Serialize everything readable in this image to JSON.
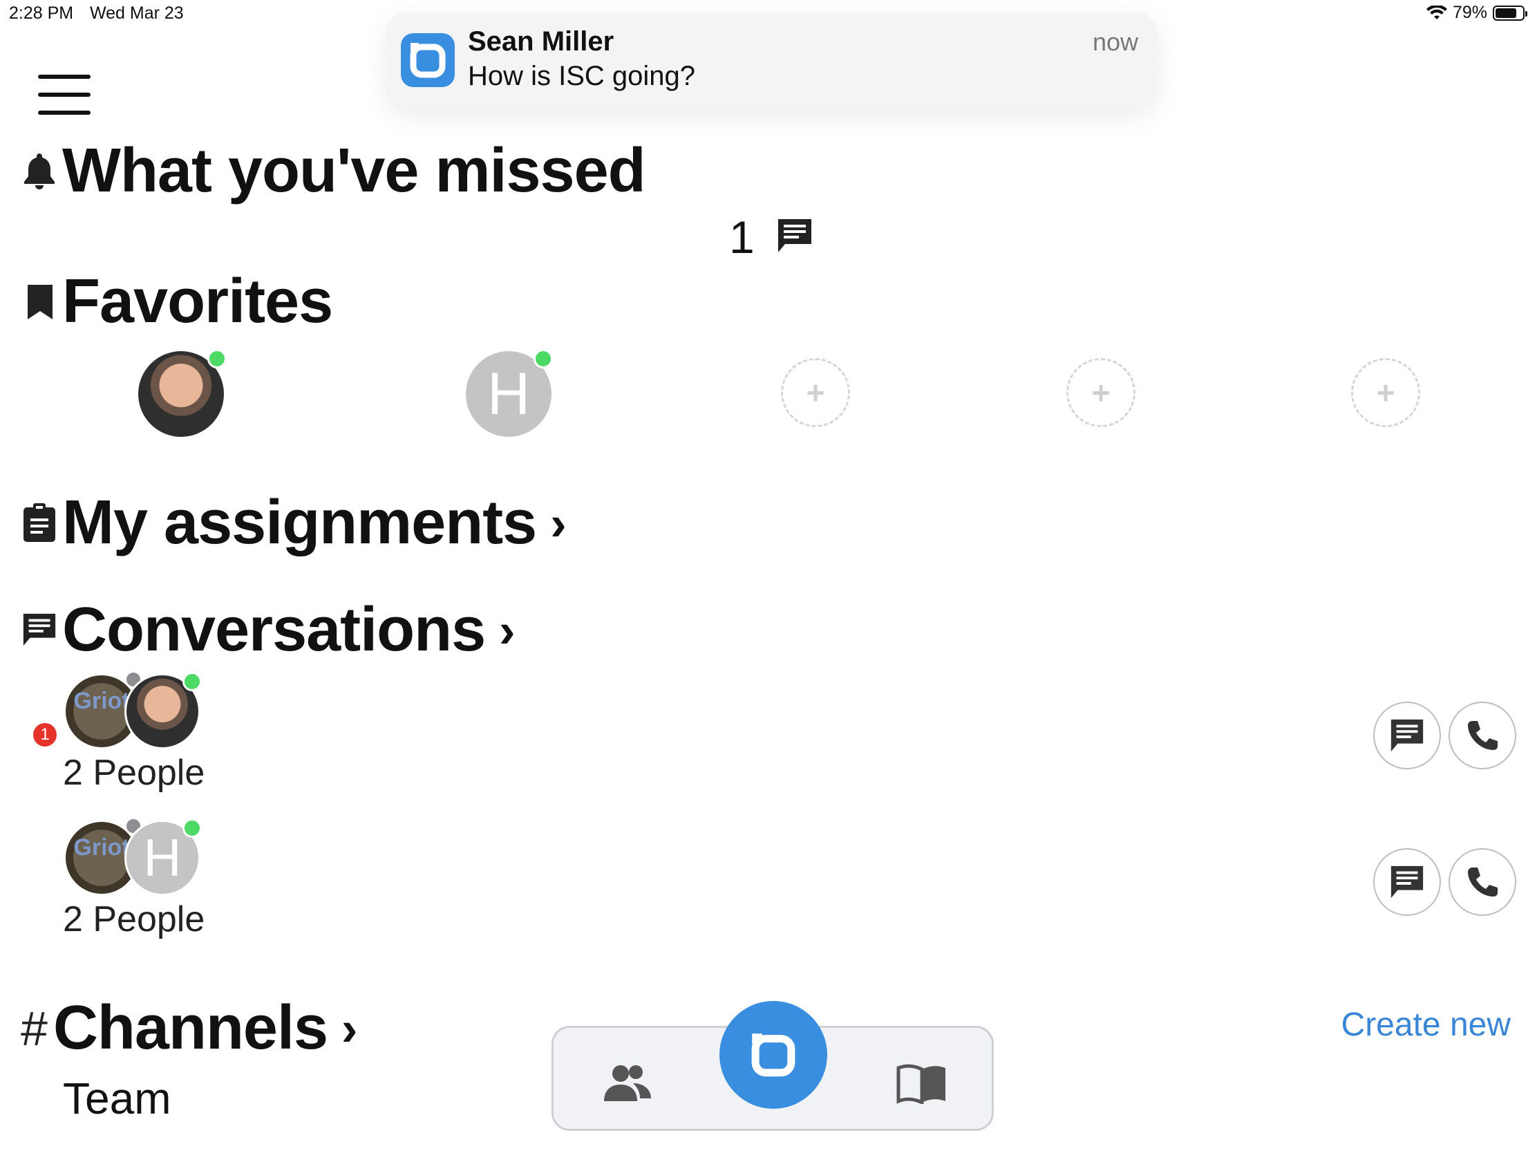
{
  "status_bar": {
    "time": "2:28 PM",
    "date": "Wed Mar 23",
    "battery": "79%",
    "battery_level": 0.79
  },
  "notification": {
    "title": "Sean Miller",
    "body": "How is ISC going?",
    "time": "now",
    "app_icon": "app-logo-icon"
  },
  "missed": {
    "title": "What you've missed",
    "count": "1",
    "icon": "bell-icon",
    "count_icon": "message-icon"
  },
  "favorites": {
    "title": "Favorites",
    "icon": "bookmark-icon",
    "items": [
      {
        "type": "photo",
        "online": true
      },
      {
        "type": "initial",
        "initial": "H",
        "online": true
      },
      {
        "type": "add",
        "glyph": "+"
      },
      {
        "type": "add",
        "glyph": "+"
      },
      {
        "type": "add",
        "glyph": "+"
      }
    ]
  },
  "assignments": {
    "title": "My assignments",
    "icon": "clipboard-icon",
    "chevron": "›"
  },
  "conversations": {
    "title": "Conversations",
    "icon": "message-icon",
    "chevron": "›",
    "items": [
      {
        "label": "2 People",
        "unread": "1",
        "avatar_text": "Griot"
      },
      {
        "label": "2 People",
        "unread": "",
        "avatar_text": "Griot",
        "second_initial": "H"
      }
    ]
  },
  "channels": {
    "prefix": "#",
    "title": "Channels",
    "chevron": "›",
    "create_label": "Create new",
    "items": [
      "Team"
    ]
  },
  "tabbar": {
    "left_icon": "people-icon",
    "center_icon": "app-logo-icon",
    "right_icon": "book-icon"
  },
  "colors": {
    "accent": "#3a8ee0",
    "online": "#4cd964",
    "badge": "#e5332a",
    "link": "#3a86d6"
  }
}
